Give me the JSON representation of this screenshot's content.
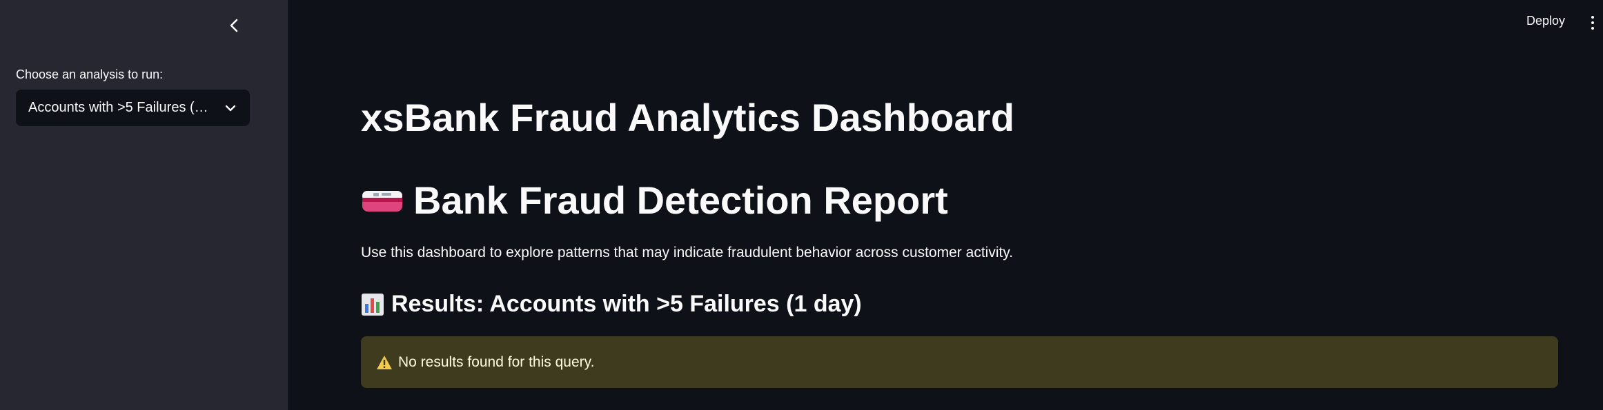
{
  "sidebar": {
    "collapse_icon": "chevron-left-icon",
    "label": "Choose an analysis to run:",
    "select": {
      "value": "Accounts with >5 Failures (…",
      "chevron_icon": "chevron-down-icon"
    }
  },
  "header": {
    "deploy_label": "Deploy",
    "menu_icon": "vertical-dots-icon"
  },
  "main": {
    "title": "xsBank Fraud Analytics Dashboard",
    "report_title": "Bank Fraud Detection Report",
    "report_icon": "credit-card-icon",
    "intro": "Use this dashboard to explore patterns that may indicate fraudulent behavior across customer activity.",
    "results_heading": "Results: Accounts with >5 Failures (1 day)",
    "results_icon": "bar-chart-icon",
    "alert": {
      "icon": "warning-icon",
      "text": "No results found for this query."
    }
  },
  "colors": {
    "background": "#0e1117",
    "sidebar": "#262730",
    "alert_background": "#3e3b1e",
    "warning": "#f2c94c"
  }
}
